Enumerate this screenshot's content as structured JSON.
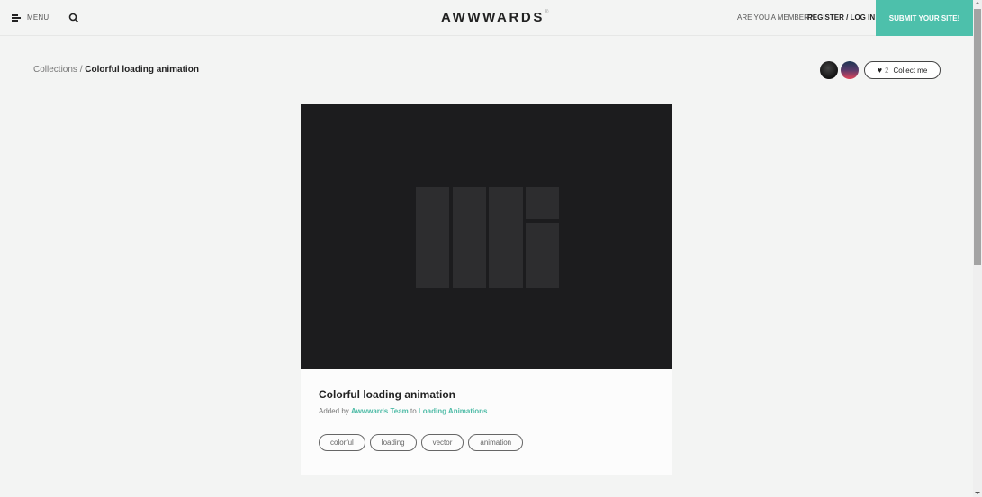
{
  "header": {
    "menu_label": "MENU",
    "logo": "AWWWARDS",
    "logo_mark": "®",
    "member_prompt": "ARE YOU A MEMBER?",
    "login_label": "REGISTER / LOG IN",
    "submit_label": "SUBMIT YOUR SITE!",
    "accent_color": "#4dc0ab"
  },
  "breadcrumb": {
    "parent": "Collections",
    "separator": " / ",
    "current": "Colorful loading animation"
  },
  "collect": {
    "count": "2",
    "label": "Collect me",
    "icon": "heart-icon"
  },
  "card": {
    "title": "Colorful loading animation",
    "added_by_prefix": "Added by ",
    "author": "Awwwards Team",
    "to_text": " to ",
    "collection": "Loading Animations",
    "tags": [
      "colorful",
      "loading",
      "vector",
      "animation"
    ]
  }
}
